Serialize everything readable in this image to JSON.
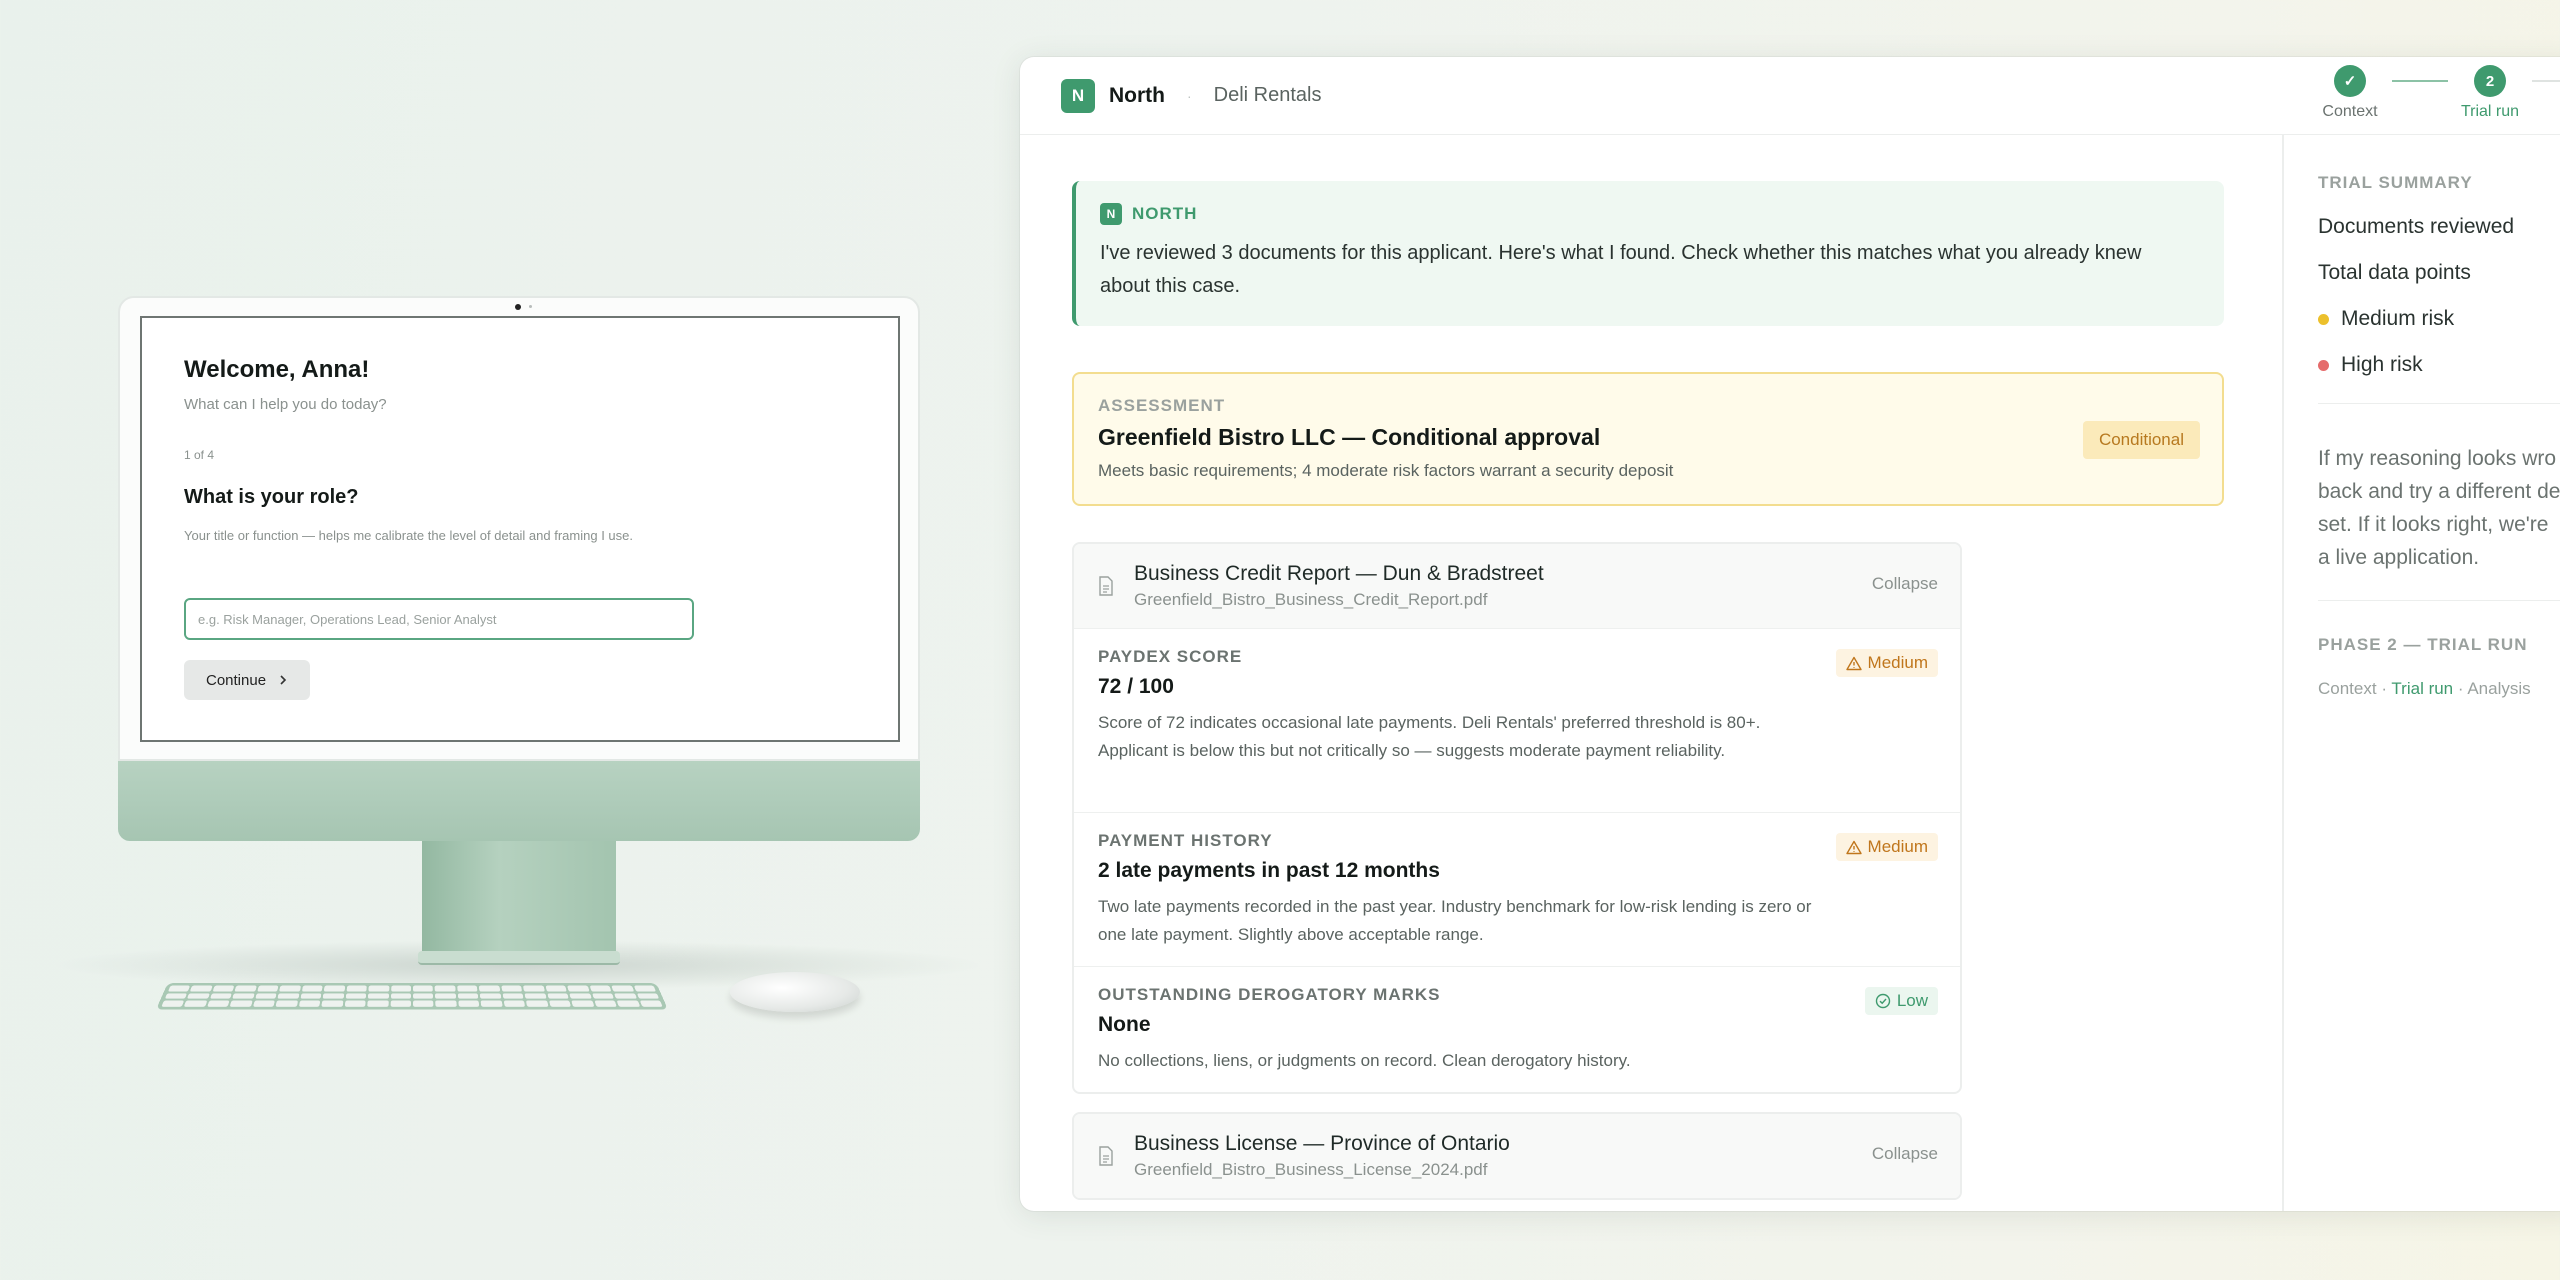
{
  "desktop": {
    "title": "Welcome, Anna!",
    "subtitle": "What can I help you do today?",
    "step": "1 of 4",
    "question": "What is your role?",
    "help": "Your title or function — helps me calibrate the level of detail and framing I use.",
    "input_placeholder": "e.g. Risk Manager, Operations Lead, Senior Analyst",
    "continue_label": "Continue",
    "continue_icon": "chevron-right-icon"
  },
  "app": {
    "logo_letter": "N",
    "brand": "North",
    "separator": "·",
    "client": "Deli Rentals",
    "steps": [
      {
        "label": "Context",
        "mark": "✓",
        "state": "done"
      },
      {
        "label": "Trial run",
        "mark": "2",
        "state": "active"
      }
    ]
  },
  "north_message": {
    "logo_letter": "N",
    "name": "NORTH",
    "text": "I've reviewed 3 documents for this applicant. Here's what I found. Check whether this matches what you already knew about this case."
  },
  "assessment": {
    "kicker": "ASSESSMENT",
    "title": "Greenfield Bistro LLC — Conditional approval",
    "description": "Meets basic requirements; 4 moderate risk factors warrant a security deposit",
    "badge": "Conditional"
  },
  "documents": [
    {
      "title": "Business Credit Report — Dun & Bradstreet",
      "file": "Greenfield_Bistro_Business_Credit_Report.pdf",
      "collapse_label": "Collapse",
      "findings": [
        {
          "kicker": "PAYDEX SCORE",
          "value": "72 / 100",
          "text": "Score of 72 indicates occasional late payments. Deli Rentals' preferred threshold is 80+. Applicant is below this but not critically so — suggests moderate payment reliability.",
          "severity": "Medium"
        },
        {
          "kicker": "PAYMENT HISTORY",
          "value": "2 late payments in past 12 months",
          "text": "Two late payments recorded in the past year. Industry benchmark for low-risk lending is zero or one late payment. Slightly above acceptable range.",
          "severity": "Medium"
        },
        {
          "kicker": "OUTSTANDING DEROGATORY MARKS",
          "value": "None",
          "text": "No collections, liens, or judgments on record. Clean derogatory history.",
          "severity": "Low"
        }
      ]
    },
    {
      "title": "Business License — Province of Ontario",
      "file": "Greenfield_Bistro_Business_License_2024.pdf",
      "collapse_label": "Collapse"
    }
  ],
  "sidebar": {
    "kicker": "TRIAL SUMMARY",
    "rows": [
      {
        "label": "Documents reviewed"
      },
      {
        "label": "Total data points"
      },
      {
        "label": "Medium risk",
        "color": "#ecc02c"
      },
      {
        "label": "High risk",
        "color": "#e56b6b"
      }
    ],
    "note_lines": [
      "If my reasoning looks wro",
      "back and try a different de",
      "set. If it looks right, we're",
      "a live application."
    ],
    "phase": "PHASE 2 — TRIAL RUN",
    "crumbs": {
      "a": "Context",
      "sep": "·",
      "b": "Trial run",
      "c": "Analysis"
    }
  },
  "colors": {
    "brand": "#3f9a6e",
    "medium": "#c0761c",
    "low": "#3f9a6e",
    "conditional_bg": "#fffbea"
  }
}
